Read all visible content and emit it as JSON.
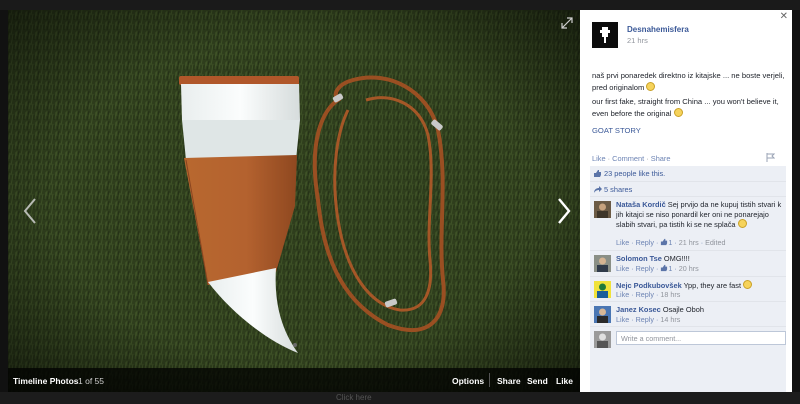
{
  "viewer": {
    "album_label": "Timeline Photos",
    "photo_count": "1 of 55",
    "actions": [
      "Options",
      "Share",
      "Send",
      "Like"
    ]
  },
  "post": {
    "page_name": "Desnahemisfera",
    "time": "21 hrs",
    "text_slovene": "naš prvi ponaredek direktno iz kitajske ... ne boste verjeli, pred originalom",
    "text_english": "our first fake, straight from China ... you won't believe it, even before the original",
    "link_label": "GOAT STORY",
    "actions": {
      "like": "Like",
      "comment": "Comment",
      "share": "Share"
    },
    "likes": "23 people like this.",
    "shares": "5 shares"
  },
  "comments": [
    {
      "author": "Nataša Kordič",
      "text": "Sej prvijo da ne kupuj tistih stvari k jih kitajci se niso ponardil ker oni ne ponarejajo slabih stvari, pa tistih ki se ne splača",
      "like": "Like",
      "reply": "Reply",
      "like_count": "1",
      "time": "21 hrs",
      "edited": "Edited"
    },
    {
      "author": "Solomon Tse",
      "text": "OMG!!!!",
      "like": "Like",
      "reply": "Reply",
      "like_count": "1",
      "time": "20 hrs"
    },
    {
      "author": "Nejc Podkubovšek",
      "text": "Ypp, they are fast",
      "like": "Like",
      "reply": "Reply",
      "time": "18 hrs"
    },
    {
      "author": "Janez Kosec",
      "text": "Osajle Oboh",
      "like": "Like",
      "reply": "Reply",
      "time": "14 hrs"
    }
  ],
  "comment_box": {
    "placeholder": "Write a comment..."
  },
  "footer_ghost": "Click here",
  "colors": {
    "facebook_blue": "#3b5998",
    "ufi_bg": "#eceff5",
    "leather": "#b4622f"
  },
  "icons": [
    "expand-icon",
    "chevron-left-icon",
    "chevron-right-icon",
    "close-icon",
    "flag-icon",
    "thumbs-up-icon",
    "share-arrow-icon"
  ]
}
